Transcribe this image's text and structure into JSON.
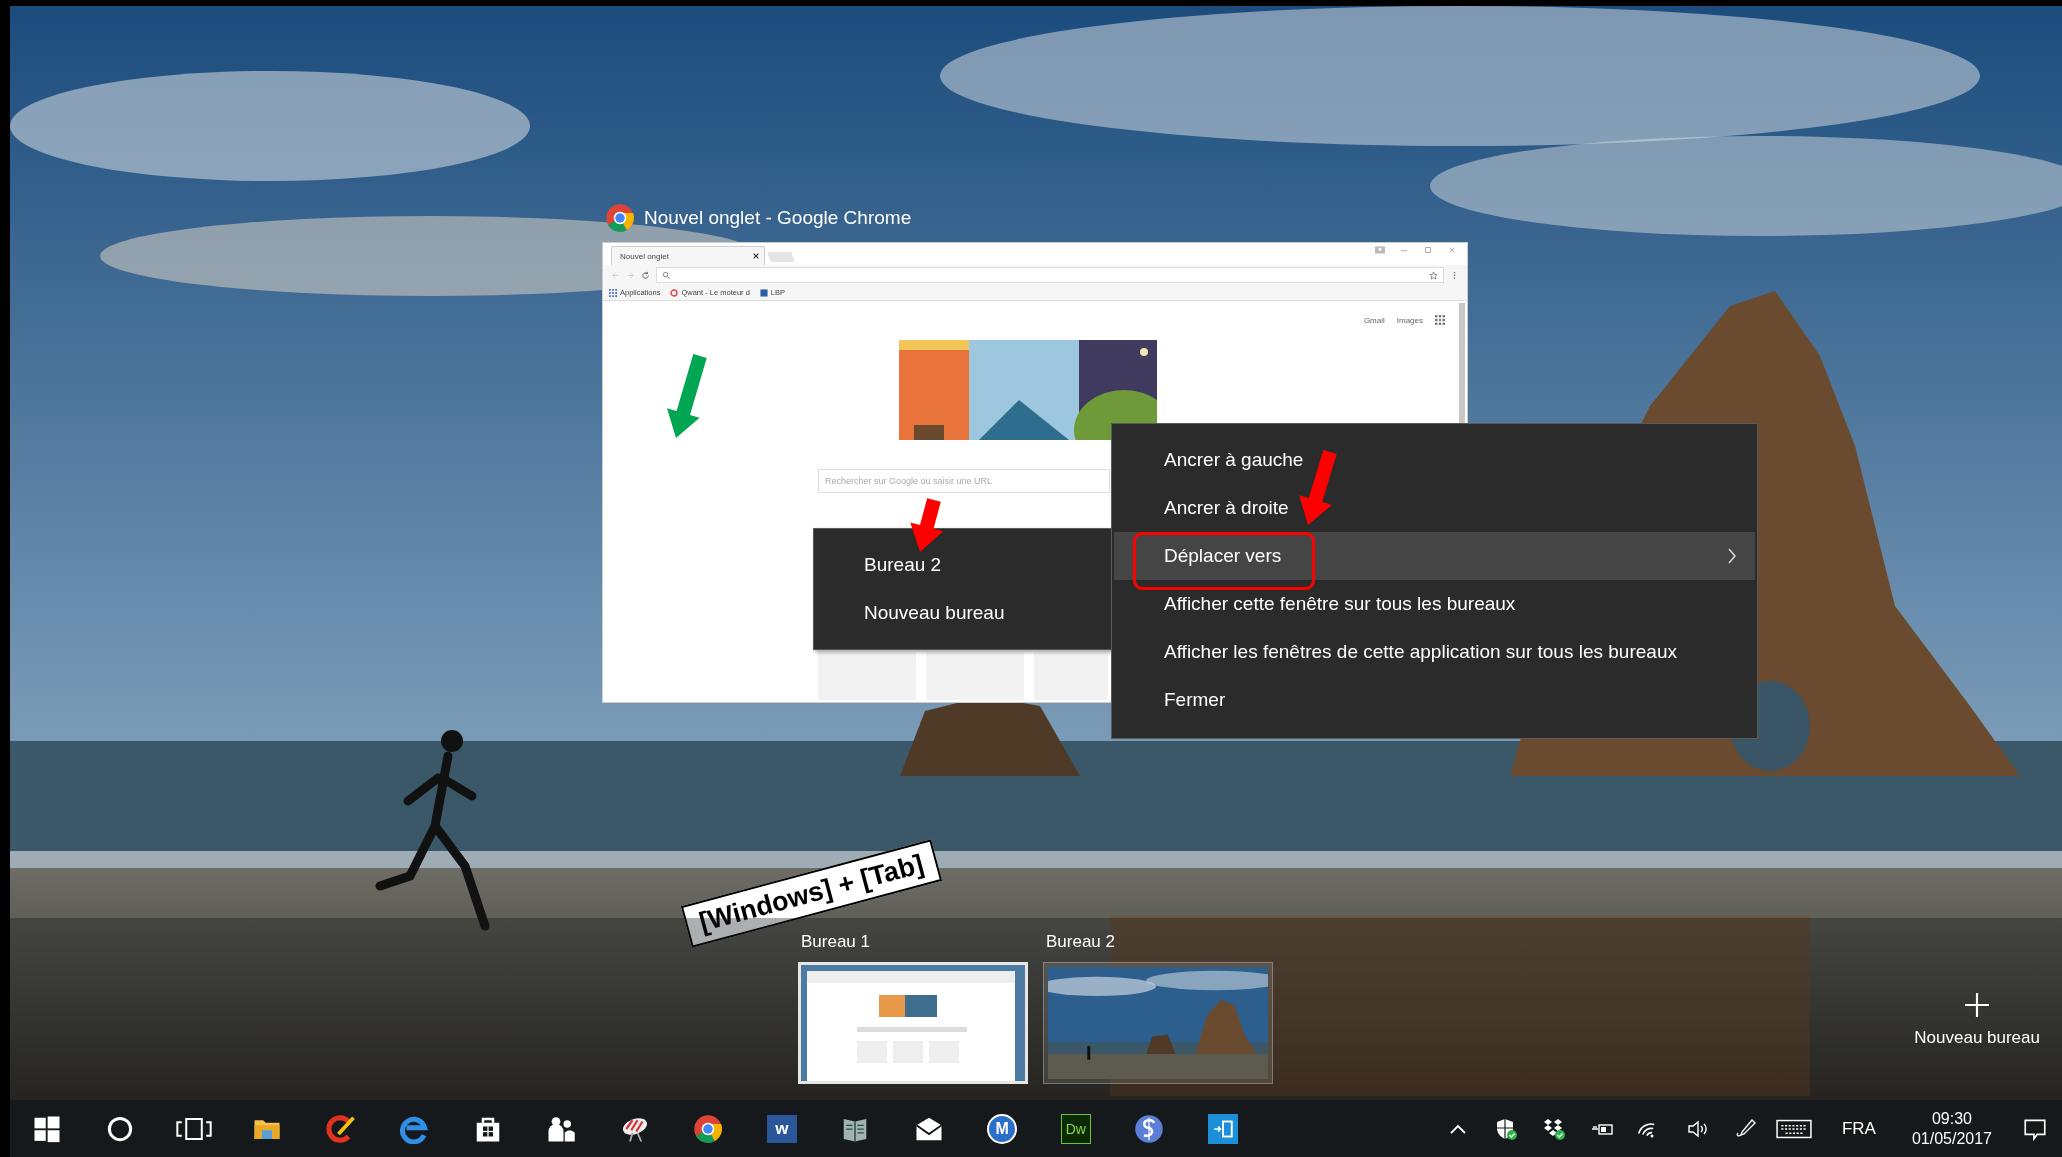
{
  "window_caption": {
    "title": "Nouvel onglet - Google Chrome"
  },
  "browser": {
    "tab": "Nouvel onglet",
    "bookmarks": [
      {
        "kind": "apps",
        "label": "Applications"
      },
      {
        "kind": "ring",
        "label": "Qwant - Le moteur d"
      },
      {
        "kind": "square",
        "label": "LBP"
      }
    ],
    "header_links": [
      "Gmail",
      "Images"
    ],
    "search_placeholder": "Rechercher sur Google ou saisir une URL"
  },
  "context_menu": {
    "items": [
      {
        "label": "Ancrer à gauche",
        "selected": false,
        "submenu": false
      },
      {
        "label": "Ancrer à droite",
        "selected": false,
        "submenu": false
      },
      {
        "label": "Déplacer vers",
        "selected": true,
        "submenu": true
      },
      {
        "label": "Afficher cette fenêtre sur tous les bureaux",
        "selected": false,
        "submenu": false
      },
      {
        "label": "Afficher les fenêtres de cette application sur tous les bureaux",
        "selected": false,
        "submenu": false
      },
      {
        "label": "Fermer",
        "selected": false,
        "submenu": false
      }
    ]
  },
  "submenu": {
    "items": [
      "Bureau 2",
      "Nouveau bureau"
    ]
  },
  "annotation": {
    "label": "[Windows] + [Tab]"
  },
  "desktops": [
    {
      "label": "Bureau 1",
      "selected": true,
      "kind": "window_preview"
    },
    {
      "label": "Bureau 2",
      "selected": false,
      "kind": "picture"
    }
  ],
  "new_desktop": {
    "label": "Nouveau bureau"
  },
  "taskbar": {
    "apps": [
      {
        "kind": "start"
      },
      {
        "kind": "search"
      },
      {
        "kind": "taskview"
      },
      {
        "kind": "folder"
      },
      {
        "kind": "brush"
      },
      {
        "kind": "edge"
      },
      {
        "kind": "bag"
      },
      {
        "kind": "people"
      },
      {
        "kind": "shell"
      },
      {
        "kind": "browser"
      },
      {
        "kind": "doc",
        "label": "w"
      },
      {
        "kind": "book"
      },
      {
        "kind": "mail"
      },
      {
        "kind": "circle_letter",
        "label": "M"
      },
      {
        "kind": "square_letter",
        "label": "Dw"
      },
      {
        "kind": "swirl"
      },
      {
        "kind": "tile"
      }
    ],
    "tray": [
      {
        "kind": "chevron"
      },
      {
        "kind": "shield"
      },
      {
        "kind": "boxes"
      },
      {
        "kind": "battery"
      },
      {
        "kind": "wifi"
      },
      {
        "kind": "speaker"
      },
      {
        "kind": "pen"
      },
      {
        "kind": "keyboard"
      }
    ],
    "language": "FRA",
    "time": "09:30",
    "date": "01/05/2017"
  }
}
